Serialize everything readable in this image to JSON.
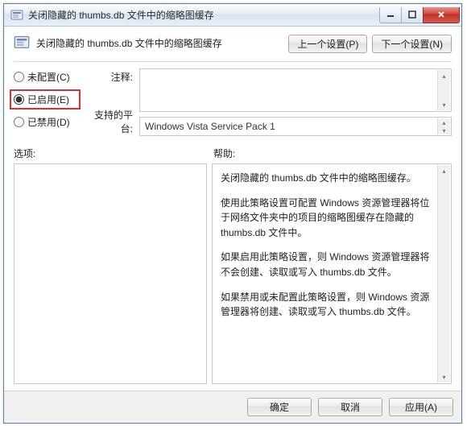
{
  "window": {
    "title": "关闭隐藏的 thumbs.db 文件中的缩略图缓存"
  },
  "header": {
    "title": "关闭隐藏的 thumbs.db 文件中的缩略图缓存",
    "prev_button": "上一个设置(P)",
    "next_button": "下一个设置(N)"
  },
  "radios": {
    "not_configured": "未配置(C)",
    "enabled": "已启用(E)",
    "disabled": "已禁用(D)",
    "selected": "enabled"
  },
  "labels": {
    "comment": "注释:",
    "platform": "支持的平台:",
    "options": "选项:",
    "help": "帮助:"
  },
  "platform_value": "Windows Vista Service Pack 1",
  "help": {
    "p1": "关闭隐藏的 thumbs.db 文件中的缩略图缓存。",
    "p2": "使用此策略设置可配置 Windows 资源管理器将位于网络文件夹中的项目的缩略图缓存在隐藏的 thumbs.db 文件中。",
    "p3": "如果启用此策略设置，则 Windows 资源管理器将不会创建、读取或写入 thumbs.db 文件。",
    "p4": "如果禁用或未配置此策略设置，则 Windows 资源管理器将创建、读取或写入 thumbs.db 文件。"
  },
  "footer": {
    "ok": "确定",
    "cancel": "取消",
    "apply": "应用(A)"
  }
}
